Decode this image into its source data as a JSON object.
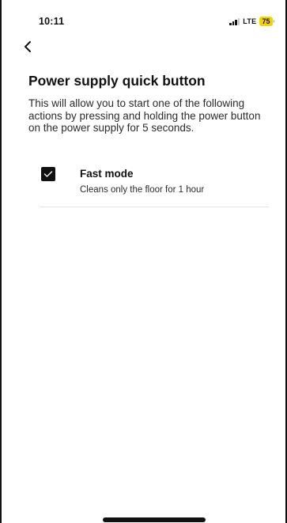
{
  "status_bar": {
    "time": "10:11",
    "network": "LTE",
    "battery": "75"
  },
  "header": {
    "back_icon": "chevron-left-icon"
  },
  "page": {
    "title": "Power supply quick button",
    "description": "This will allow you to start one of the following actions by pressing and holding the power button on the power supply for 5 seconds."
  },
  "options": [
    {
      "title": "Fast mode",
      "subtitle": "Cleans only the floor for 1 hour",
      "checked": true
    }
  ],
  "colors": {
    "battery_badge": "#f5d300",
    "checkbox_fill": "#111111",
    "text_primary": "#111111"
  }
}
